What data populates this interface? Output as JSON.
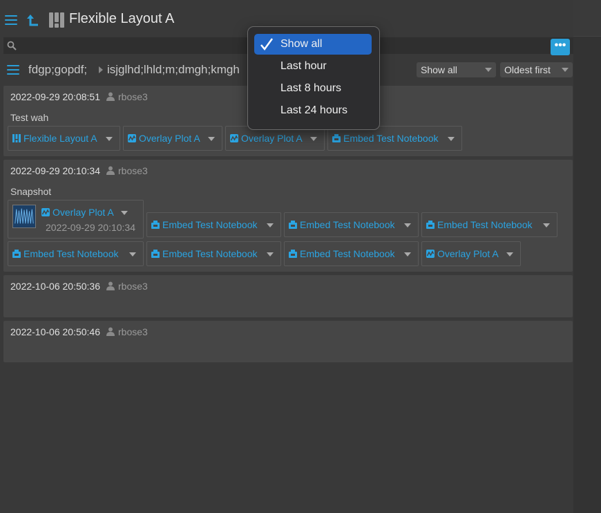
{
  "app": {
    "title": "Flexible Layout A"
  },
  "search": {
    "placeholder": ""
  },
  "more_button": {
    "label": "•••"
  },
  "breadcrumb": {
    "first": "fdgp;gopdf;",
    "second": "isjglhd;lhld;m;dmgh;kmgh"
  },
  "filters": {
    "time_value": "Show all",
    "sort_value": "Oldest first"
  },
  "time_menu": {
    "items": [
      {
        "label": "Show all",
        "selected": true
      },
      {
        "label": "Last hour",
        "selected": false
      },
      {
        "label": "Last 8 hours",
        "selected": false
      },
      {
        "label": "Last 24 hours",
        "selected": false
      }
    ]
  },
  "entries": [
    {
      "timestamp": "2022-09-29 20:08:51",
      "user": "rbose3",
      "text": "Test wah",
      "chips": [
        {
          "label": "Flexible Layout A",
          "icon": "layout-icon"
        },
        {
          "label": "Overlay Plot A",
          "icon": "plot-icon"
        },
        {
          "label": "Overlay Plot A",
          "icon": "plot-icon"
        },
        {
          "label": "Embed Test Notebook",
          "icon": "notebook-icon"
        }
      ]
    },
    {
      "timestamp": "2022-09-29 20:10:34",
      "user": "rbose3",
      "text": "Snapshot",
      "snapshot": {
        "label": "Overlay Plot A",
        "time": "2022-09-29 20:10:34"
      },
      "chips": [
        {
          "label": "Embed Test Notebook",
          "icon": "notebook-icon"
        },
        {
          "label": "Embed Test Notebook",
          "icon": "notebook-icon"
        },
        {
          "label": "Embed Test Notebook",
          "icon": "notebook-icon"
        },
        {
          "label": "Embed Test Notebook",
          "icon": "notebook-icon"
        },
        {
          "label": "Embed Test Notebook",
          "icon": "notebook-icon"
        },
        {
          "label": "Embed Test Notebook",
          "icon": "notebook-icon"
        },
        {
          "label": "Overlay Plot A",
          "icon": "plot-icon"
        }
      ]
    },
    {
      "timestamp": "2022-10-06 20:50:36",
      "user": "rbose3"
    },
    {
      "timestamp": "2022-10-06 20:50:46",
      "user": "rbose3"
    }
  ],
  "colors": {
    "accent": "#2a9fd8",
    "menu_selected": "#2366c4",
    "link": "#2aa4e2"
  }
}
